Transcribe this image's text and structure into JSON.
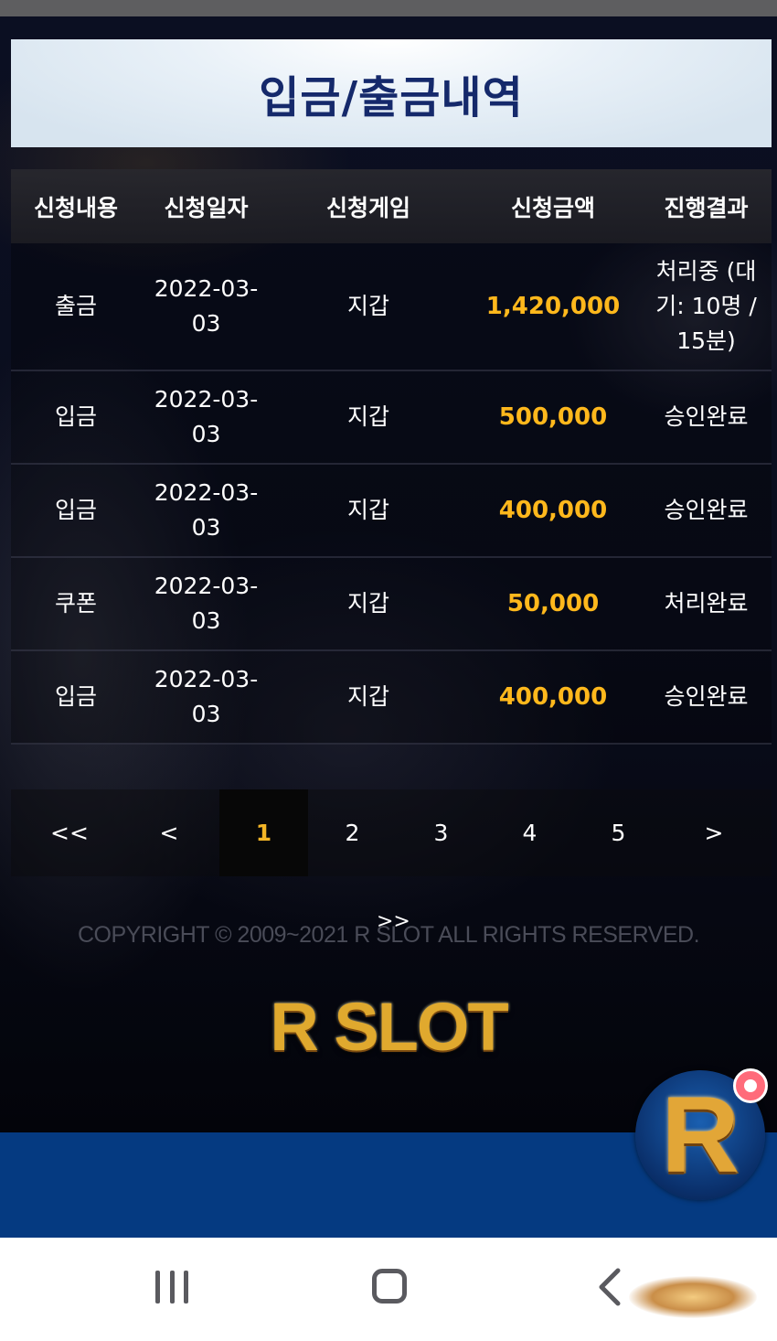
{
  "page": {
    "title": "입금/출금내역"
  },
  "table": {
    "headers": [
      "신청내용",
      "신청일자",
      "신청게임",
      "신청금액",
      "진행결과"
    ],
    "rows": [
      {
        "type": "출금",
        "date_line1": "2022-03-",
        "date_line2": "03",
        "game": "지갑",
        "amount": "1,420,000",
        "result_line1": "처리중 (대",
        "result_line2": "기: 10명 /",
        "result_line3": "15분)"
      },
      {
        "type": "입금",
        "date_line1": "2022-03-",
        "date_line2": "03",
        "game": "지갑",
        "amount": "500,000",
        "result_line1": "승인완료",
        "result_line2": "",
        "result_line3": ""
      },
      {
        "type": "입금",
        "date_line1": "2022-03-",
        "date_line2": "03",
        "game": "지갑",
        "amount": "400,000",
        "result_line1": "승인완료",
        "result_line2": "",
        "result_line3": ""
      },
      {
        "type": "쿠폰",
        "date_line1": "2022-03-",
        "date_line2": "03",
        "game": "지갑",
        "amount": "50,000",
        "result_line1": "처리완료",
        "result_line2": "",
        "result_line3": ""
      },
      {
        "type": "입금",
        "date_line1": "2022-03-",
        "date_line2": "03",
        "game": "지갑",
        "amount": "400,000",
        "result_line1": "승인완료",
        "result_line2": "",
        "result_line3": ""
      }
    ]
  },
  "pagination": {
    "first": "<<",
    "prev": "<",
    "pages": [
      "1",
      "2",
      "3",
      "4",
      "5"
    ],
    "current": "1",
    "next": ">",
    "last": ">>"
  },
  "footer": {
    "copyright": "COPYRIGHT © 2009~2021 R SLOT ALL RIGHTS RESERVED.",
    "logo_text": "R SLOT"
  },
  "floating_button": {
    "letter": "R",
    "icon": "r-slot-chat-icon"
  },
  "system_nav": {
    "recent_icon": "recent-apps-icon",
    "home_icon": "home-icon",
    "back_icon": "back-icon"
  },
  "colors": {
    "title": "#15296b",
    "amount": "#ffb81c",
    "active_page": "#f3b526",
    "blue_band": "#053a81",
    "notification_dot": "#ff6b7a"
  }
}
